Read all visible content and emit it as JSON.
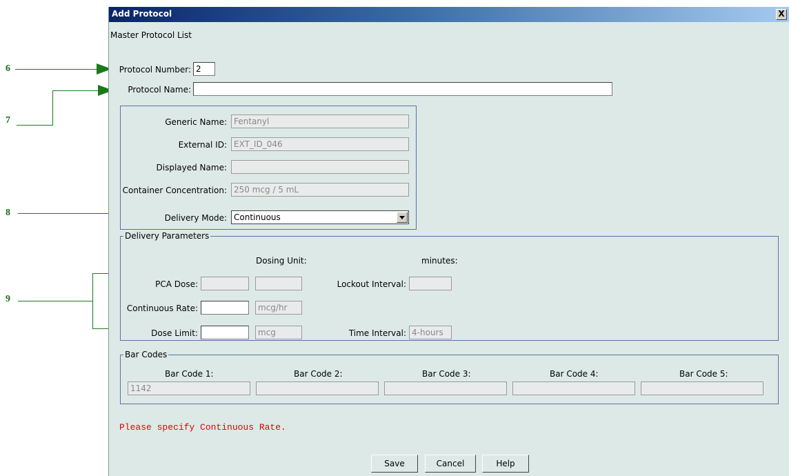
{
  "callouts": [
    "6",
    "7",
    "8",
    "9"
  ],
  "dialog": {
    "title": "Add Protocol",
    "close_label": "X",
    "breadcrumb": "Master Protocol List",
    "protocol_number_label": "Protocol Number:",
    "protocol_number_value": "2",
    "protocol_name_label": "Protocol Name:",
    "protocol_name_value": ""
  },
  "drug": {
    "generic_name_label": "Generic Name:",
    "generic_name_value": "Fentanyl",
    "external_id_label": "External ID:",
    "external_id_value": "EXT_ID_046",
    "displayed_name_label": "Displayed Name:",
    "displayed_name_value": "",
    "container_conc_label": "Container Concentration:",
    "container_conc_value": "250 mcg / 5 mL",
    "delivery_mode_label": "Delivery Mode:",
    "delivery_mode_value": "Continuous"
  },
  "delivery": {
    "legend": "Delivery Parameters",
    "dosing_unit_label": "Dosing Unit:",
    "minutes_label": "minutes:",
    "pca_dose_label": "PCA Dose:",
    "pca_dose_value": "",
    "pca_unit_value": "",
    "lockout_label": "Lockout Interval:",
    "lockout_value": "",
    "continuous_rate_label": "Continuous Rate:",
    "continuous_rate_value": "",
    "continuous_rate_unit": "mcg/hr",
    "dose_limit_label": "Dose Limit:",
    "dose_limit_value": "",
    "dose_limit_unit": "mcg",
    "time_interval_label": "Time Interval:",
    "time_interval_value": "4-hours"
  },
  "barcodes": {
    "legend": "Bar Codes",
    "items": [
      {
        "label": "Bar Code 1:",
        "value": "1142"
      },
      {
        "label": "Bar Code 2:",
        "value": ""
      },
      {
        "label": "Bar Code 3:",
        "value": ""
      },
      {
        "label": "Bar Code 4:",
        "value": ""
      },
      {
        "label": "Bar Code 5:",
        "value": ""
      }
    ]
  },
  "error": "Please specify Continuous Rate.",
  "buttons": {
    "save": "Save",
    "cancel": "Cancel",
    "help": "Help"
  }
}
